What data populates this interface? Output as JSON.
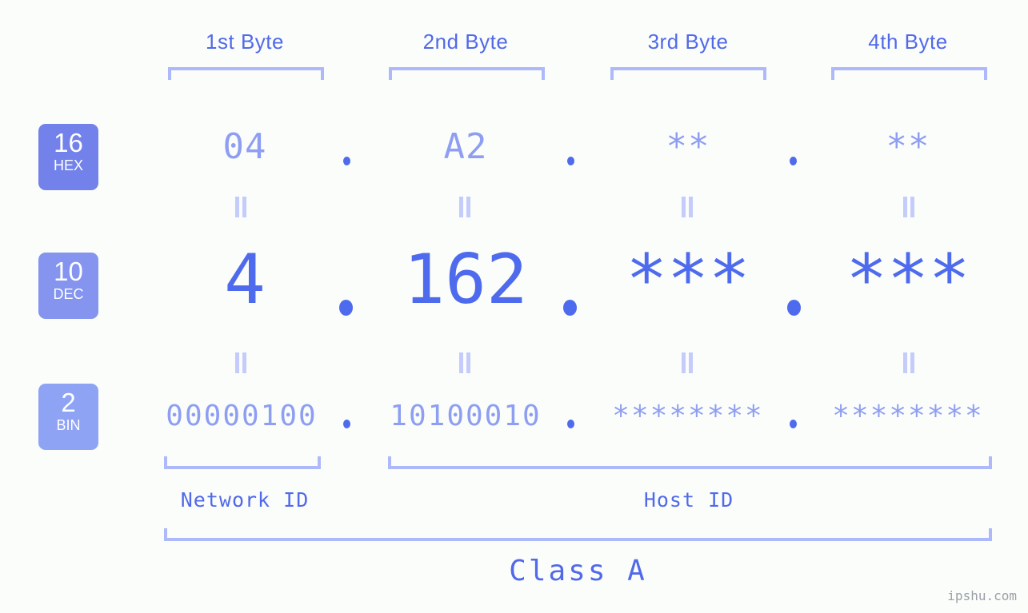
{
  "meta": {
    "background": "#fbfdfa",
    "accent_strong": "#4f6bed",
    "accent_mid": "#8e9ef2",
    "accent_light": "#aeb9fb"
  },
  "byte_headers": [
    {
      "label": "1st Byte"
    },
    {
      "label": "2nd Byte"
    },
    {
      "label": "3rd Byte"
    },
    {
      "label": "4th Byte"
    }
  ],
  "rows": [
    {
      "badge": {
        "number": "16",
        "name": "HEX",
        "color": "#7382ea"
      },
      "values": [
        "04",
        "A2",
        "**",
        "**"
      ],
      "separators": [
        ".",
        ".",
        "."
      ]
    },
    {
      "badge": {
        "number": "10",
        "name": "DEC",
        "color": "#8494ef"
      },
      "values": [
        "4",
        "162",
        "***",
        "***"
      ],
      "separators": [
        ".",
        ".",
        "."
      ]
    },
    {
      "badge": {
        "number": "2",
        "name": "BIN",
        "color": "#8fa3f4"
      },
      "values": [
        "00000100",
        "10100010",
        "********",
        "********"
      ],
      "separators": [
        ".",
        ".",
        "."
      ]
    }
  ],
  "equivalence": {
    "symbol": "="
  },
  "id_sections": [
    {
      "label": "Network ID"
    },
    {
      "label": "Host ID"
    }
  ],
  "class_section": {
    "label": "Class A"
  },
  "watermark": {
    "text": "ipshu.com"
  }
}
